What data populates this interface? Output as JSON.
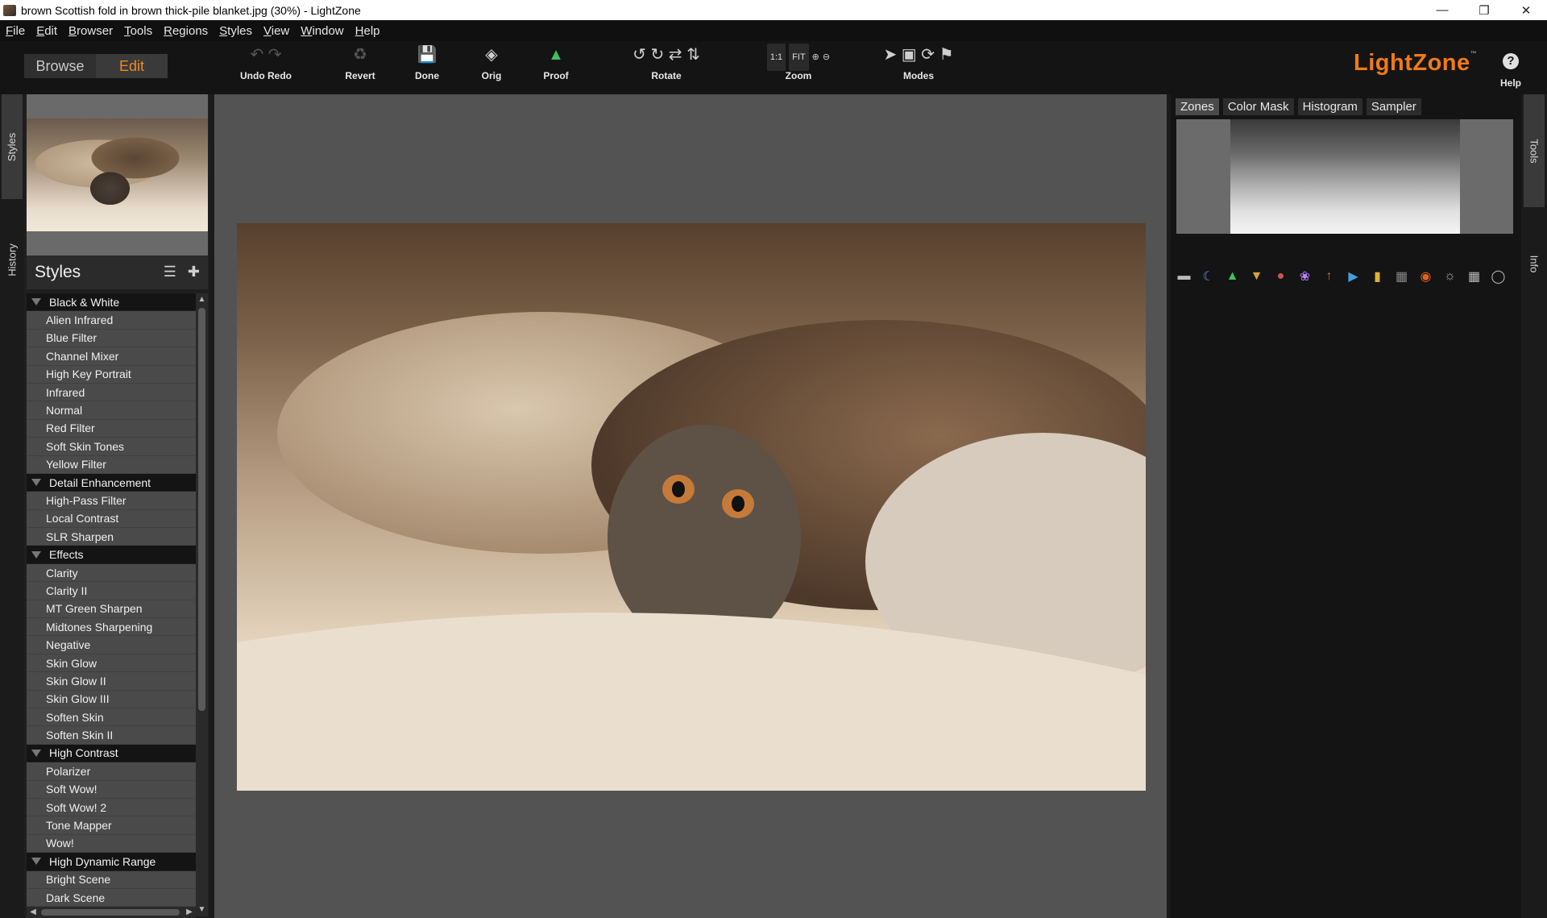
{
  "window": {
    "title": "brown Scottish fold in brown thick-pile blanket.jpg (30%) - LightZone"
  },
  "menu": [
    "File",
    "Edit",
    "Browser",
    "Tools",
    "Regions",
    "Styles",
    "View",
    "Window",
    "Help"
  ],
  "toolbar": {
    "browse": "Browse",
    "edit": "Edit",
    "undo_redo": "Undo Redo",
    "revert": "Revert",
    "done": "Done",
    "orig": "Orig",
    "proof": "Proof",
    "rotate": "Rotate",
    "zoom": "Zoom",
    "zoom_1to1": "1:1",
    "zoom_fit": "FIT",
    "modes": "Modes",
    "help": "Help"
  },
  "brand": {
    "name": "LightZone",
    "tm": "™"
  },
  "left_tabs": [
    "Styles",
    "History"
  ],
  "styles": {
    "header": "Styles",
    "categories": [
      {
        "name": "Black & White",
        "items": [
          "Alien Infrared",
          "Blue Filter",
          "Channel Mixer",
          "High Key Portrait",
          "Infrared",
          "Normal",
          "Red Filter",
          "Soft Skin Tones",
          "Yellow Filter"
        ]
      },
      {
        "name": "Detail Enhancement",
        "items": [
          "High-Pass Filter",
          "Local Contrast",
          "SLR Sharpen"
        ]
      },
      {
        "name": "Effects",
        "items": [
          "Clarity",
          "Clarity II",
          "MT Green Sharpen",
          "Midtones Sharpening",
          "Negative",
          "Skin Glow",
          "Skin Glow II",
          "Skin Glow III",
          "Soften Skin",
          "Soften Skin II"
        ]
      },
      {
        "name": "High Contrast",
        "items": [
          "Polarizer",
          "Soft Wow!",
          "Soft Wow! 2",
          "Tone Mapper",
          "Wow!"
        ]
      },
      {
        "name": "High Dynamic Range",
        "items": [
          "Bright Scene",
          "Dark Scene"
        ]
      }
    ]
  },
  "right_tabs_top": [
    "Zones",
    "Color Mask",
    "Histogram",
    "Sampler"
  ],
  "right_vertical_tabs": [
    "Tools",
    "Info"
  ],
  "colors": {
    "accent": "#f08a1c",
    "panel": "#1f1f1f",
    "canvas": "#535353"
  }
}
